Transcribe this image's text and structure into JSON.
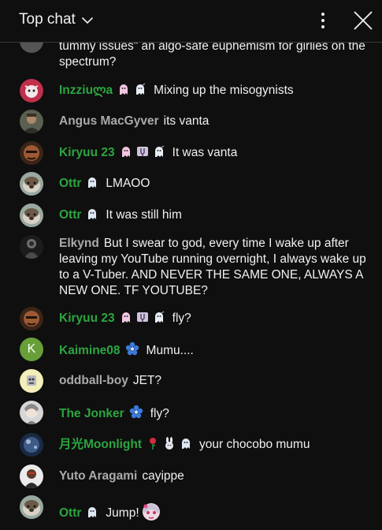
{
  "header": {
    "title": "Top chat"
  },
  "partial_message": {
    "text": "tummy issues\" an algo-safe euphemism for girlies on the spectrum?"
  },
  "messages": [
    {
      "author": "Inzziuლa",
      "text": "Mixing up the misogynists"
    },
    {
      "author": "Angus MacGyver",
      "text": "its vanta"
    },
    {
      "author": "Kiryuu 23",
      "text": "It was vanta"
    },
    {
      "author": "Ottr",
      "text": "LMAOO"
    },
    {
      "author": "Ottr",
      "text": "It was still him"
    },
    {
      "author": "Elkynd",
      "text": "But I swear to god, every time I wake up after leaving my YouTube running overnight, I always wake up to a V-Tuber. AND NEVER THE SAME ONE, ALWAYS A NEW ONE. TF YOUTUBE?"
    },
    {
      "author": "Kiryuu 23",
      "text": "fly?"
    },
    {
      "author": "Kaimine08",
      "text": "Mumu...."
    },
    {
      "author": "oddball-boy",
      "text": "JET?"
    },
    {
      "author": "The Jonker",
      "text": "fly?"
    },
    {
      "author": "月光Moonlight",
      "text": "your chocobo mumu"
    },
    {
      "author": "Yuto Aragami",
      "text": "cayippe"
    },
    {
      "author": "Ottr",
      "text": "Jump!"
    }
  ],
  "avatar_initials": {
    "kaimine": "K"
  },
  "colors": {
    "member_name": "#2ba640",
    "viewer_name": "#aaaaaa",
    "background": "#0f0f0f",
    "text": "#f1f1f1"
  },
  "icons": [
    "chevron-down-icon",
    "more-vert-icon",
    "close-icon",
    "ghost-badge-icon",
    "flower-badge-icon",
    "rose-badge-icon",
    "bunny-badge-icon",
    "tuning-fork-badge-icon"
  ]
}
